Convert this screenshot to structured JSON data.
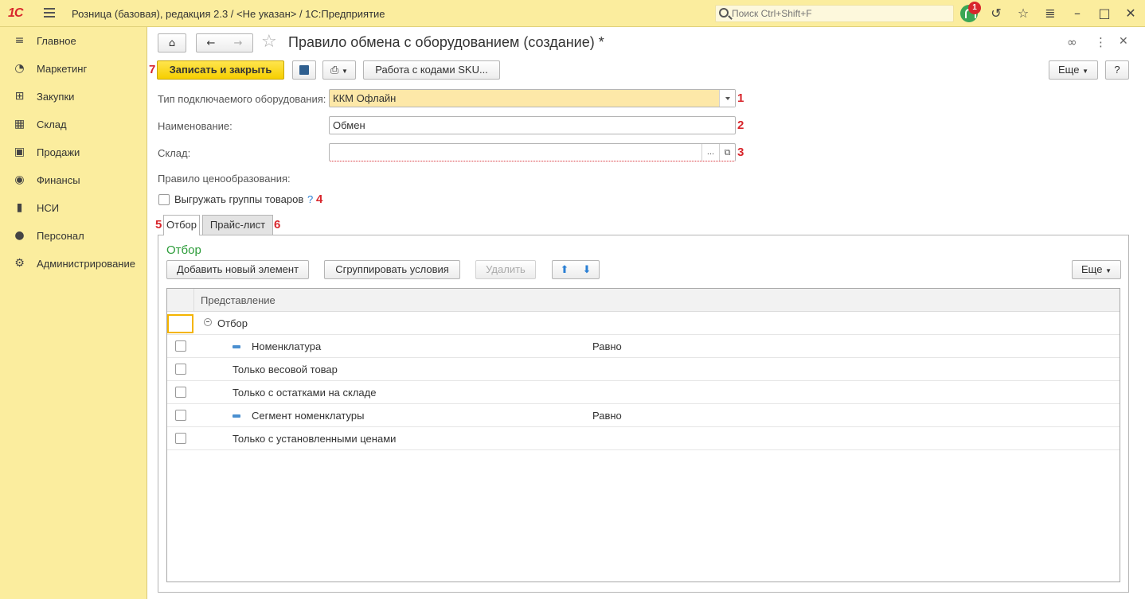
{
  "titlebar": {
    "logo": "1С",
    "title": "Розница (базовая), редакция 2.3 / <Не указан> / 1С:Предприятие",
    "search_placeholder": "Поиск Ctrl+Shift+F",
    "notification_count": "1"
  },
  "sidebar": {
    "items": [
      {
        "label": "Главное",
        "icon": "menu-icon"
      },
      {
        "label": "Маркетинг",
        "icon": "pie-chart-icon"
      },
      {
        "label": "Закупки",
        "icon": "cart-icon"
      },
      {
        "label": "Склад",
        "icon": "grid-icon"
      },
      {
        "label": "Продажи",
        "icon": "bag-icon"
      },
      {
        "label": "Финансы",
        "icon": "coin-icon"
      },
      {
        "label": "НСИ",
        "icon": "book-icon"
      },
      {
        "label": "Персонал",
        "icon": "person-icon"
      },
      {
        "label": "Администрирование",
        "icon": "gear-icon"
      }
    ]
  },
  "form": {
    "title": "Правило обмена с оборудованием (создание) *",
    "save_close_label": "Записать и закрыть",
    "sku_button_label": "Работа с кодами SKU...",
    "more_label": "Еще",
    "help_label": "?",
    "equipment_type_label": "Тип подключаемого оборудования:",
    "equipment_type_value": "ККМ Офлайн",
    "name_label": "Наименование:",
    "name_value": "Обмен",
    "warehouse_label": "Склад:",
    "warehouse_value": "",
    "warehouse_select_label": "...",
    "pricing_label": "Правило ценообразования:",
    "export_groups_label": "Выгружать группы товаров",
    "export_groups_checked": false,
    "export_groups_help": "?",
    "markers": {
      "m1": "1",
      "m2": "2",
      "m3": "3",
      "m4": "4",
      "m5": "5",
      "m6": "6",
      "m7": "7"
    }
  },
  "tabs": [
    {
      "label": "Отбор",
      "active": true
    },
    {
      "label": "Прайс-лист",
      "active": false
    }
  ],
  "filter": {
    "heading": "Отбор",
    "add_label": "Добавить новый элемент",
    "group_label": "Сгруппировать условия",
    "delete_label": "Удалить",
    "more_label": "Еще",
    "column_header": "Представление",
    "root_label": "Отбор",
    "rows": [
      {
        "label": "Номенклатура",
        "condition": "Равно",
        "checked": false
      },
      {
        "label": "Только весовой товар",
        "condition": "",
        "checked": false
      },
      {
        "label": "Только с остатками на складе",
        "condition": "",
        "checked": false
      },
      {
        "label": "Сегмент номенклатуры",
        "condition": "Равно",
        "checked": false
      },
      {
        "label": "Только с установленными ценами",
        "condition": "",
        "checked": false
      }
    ]
  },
  "colors": {
    "accent_yellow": "#fbed9e",
    "primary_button": "#f6cf00",
    "marker_red": "#d8262c",
    "heading_green": "#2d9c3a"
  }
}
